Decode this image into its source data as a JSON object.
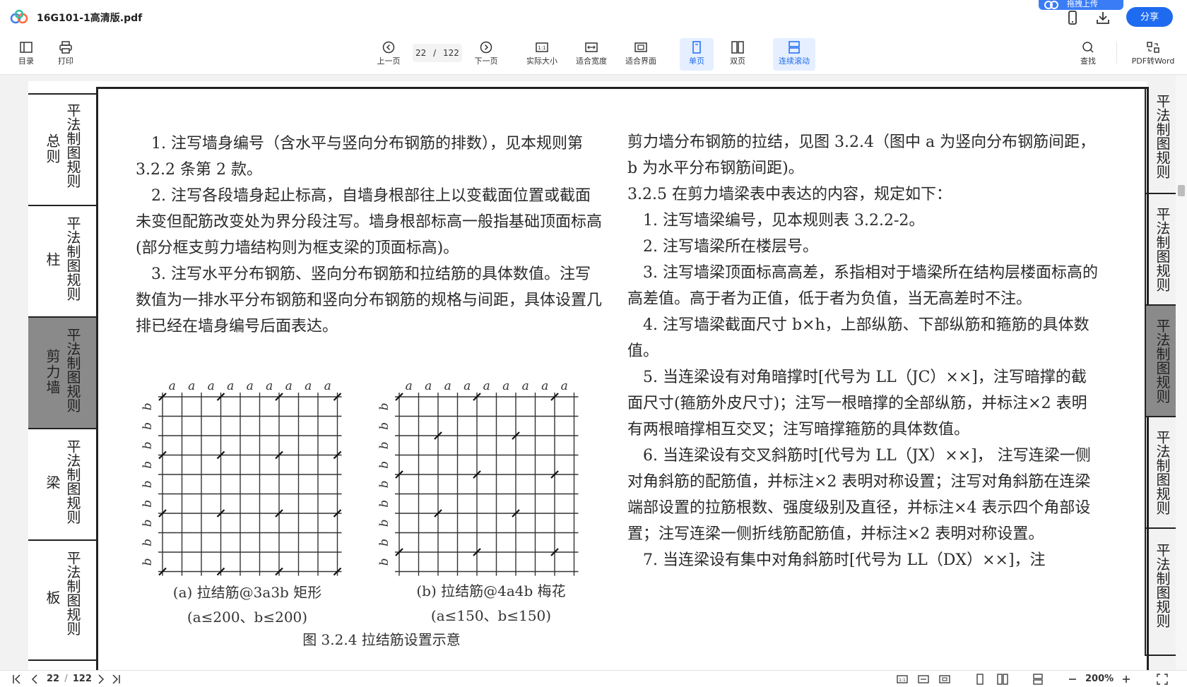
{
  "window": {
    "title": "16G101-1高清版.pdf",
    "upload_tip": "拖拽上传",
    "share_label": "分享"
  },
  "toolbar": {
    "toc": "目录",
    "print": "打印",
    "prev": "上一页",
    "current_page": "22",
    "page_sep": "/",
    "total_pages": "122",
    "next": "下一页",
    "actual_size": "实际大小",
    "fit_width": "适合宽度",
    "fit_page": "适合界面",
    "single_page": "单页",
    "double_page": "双页",
    "continuous": "连续滚动",
    "find": "查找",
    "pdf_to_word": "PDF转Word"
  },
  "side_tabs": [
    {
      "cat": "总则",
      "rule": "平法制图规则"
    },
    {
      "cat": "柱",
      "rule": "平法制图规则"
    },
    {
      "cat": "剪力墙",
      "rule": "平法制图规则"
    },
    {
      "cat": "梁",
      "rule": "平法制图规则"
    },
    {
      "cat": "板",
      "rule": "平法制图规则"
    }
  ],
  "right_tabs": [
    {
      "rule": "平法制图规则"
    },
    {
      "rule": "平法制图规则"
    },
    {
      "rule": "平法制图规则"
    },
    {
      "rule": "平法制图规则"
    },
    {
      "rule": "平法制图规则"
    }
  ],
  "content": {
    "left": [
      "1. 注写墙身编号（含水平与竖向分布钢筋的排数），见本规则第 3.2.2 条第 2 款。",
      "2. 注写各段墙身起止标高，自墙身根部往上以变截面位置或截面未变但配筋改变处为界分段注写。墙身根部标高一般指基础顶面标高(部分框支剪力墙结构则为框支梁的顶面标高)。",
      "3. 注写水平分布钢筋、竖向分布钢筋和拉结筋的具体数值。注写数值为一排水平分布钢筋和竖向分布钢筋的规格与间距，具体设置几排已经在墙身编号后面表达。"
    ],
    "right_intro": "剪力墙分布钢筋的拉结，见图 3.2.4（图中 a 为竖向分布钢筋间距， b 为水平分布钢筋间距)。",
    "right_heading": "3.2.5  在剪力墙梁表中表达的内容，规定如下：",
    "right": [
      "1. 注写墙梁编号，见本规则表 3.2.2-2。",
      "2. 注写墙梁所在楼层号。",
      "3. 注写墙梁顶面标高高差，系指相对于墙梁所在结构层楼面标高的高差值。高于者为正值，低于者为负值，当无高差时不注。",
      "4. 注写墙梁截面尺寸 b×h，上部纵筋、下部纵筋和箍筋的具体数值。",
      "5. 当连梁设有对角暗撑时[代号为 LL（JC）××]，注写暗撑的截面尺寸(箍筋外皮尺寸)；注写一根暗撑的全部纵筋，并标注×2 表明有两根暗撑相互交叉；注写暗撑箍筋的具体数值。",
      "6. 当连梁设有交叉斜筋时[代号为 LL（JX）××]， 注写连梁一侧对角斜筋的配筋值，并标注×2 表明对称设置；注写对角斜筋在连梁端部设置的拉筋根数、强度级别及直径，并标注×4 表示四个角部设置；注写连梁一侧折线筋配筋值，并标注×2 表明对称设置。",
      "7. 当连梁设有集中对角斜筋时[代号为 LL（DX）××]，注"
    ],
    "fig_a_caption1": "(a) 拉结筋@3a3b 矩形",
    "fig_a_caption2": "(a≤200、b≤200)",
    "fig_b_caption1": "(b) 拉结筋@4a4b 梅花",
    "fig_b_caption2": "(a≤150、b≤150)",
    "fig_title": "图 3.2.4  拉结筋设置示意",
    "axis_a": "a",
    "axis_b": "b"
  },
  "bottom": {
    "current_page": "22",
    "page_sep": "/",
    "total_pages": "122",
    "zoom": "200%"
  }
}
